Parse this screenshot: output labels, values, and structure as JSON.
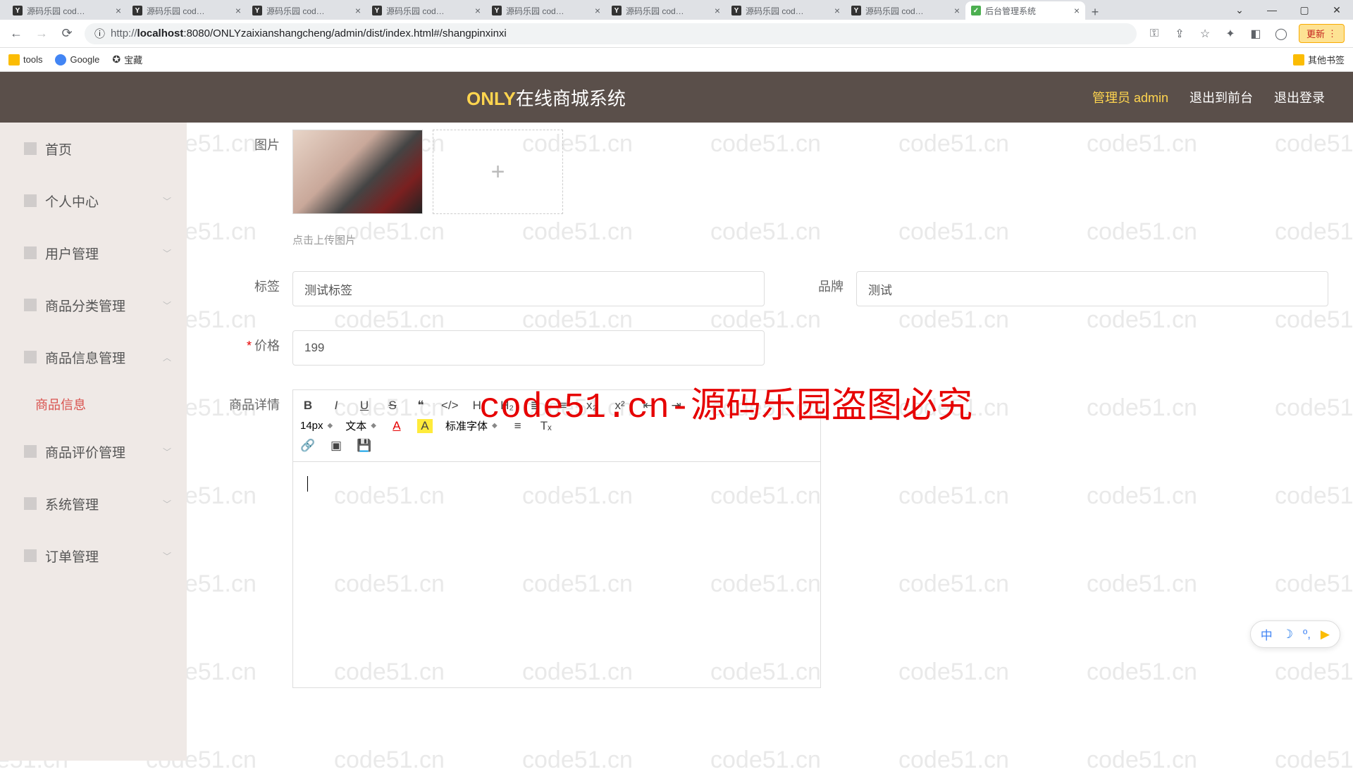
{
  "browser": {
    "tabs": [
      {
        "title": "源码乐园 cod…"
      },
      {
        "title": "源码乐园 cod…"
      },
      {
        "title": "源码乐园 cod…"
      },
      {
        "title": "源码乐园 cod…"
      },
      {
        "title": "源码乐园 cod…"
      },
      {
        "title": "源码乐园 cod…"
      },
      {
        "title": "源码乐园 cod…"
      },
      {
        "title": "源码乐园 cod…"
      },
      {
        "title": "后台管理系统",
        "active": true
      }
    ],
    "url_proto": "http://",
    "url_host": "localhost",
    "url_path": ":8080/ONLYzaixianshangcheng/admin/dist/index.html#/shangpinxinxi",
    "update": "更新",
    "bookmarks": {
      "tools": "tools",
      "google": "Google",
      "baozang": "宝藏",
      "other": "其他书签"
    }
  },
  "header": {
    "title_accent": "ONLY",
    "title_rest": "在线商城系统",
    "admin_prefix": "管理员 ",
    "admin_name": "admin",
    "to_front": "退出到前台",
    "logout": "退出登录"
  },
  "sidebar": {
    "home": "首页",
    "profile": "个人中心",
    "users": "用户管理",
    "cat": "商品分类管理",
    "info": "商品信息管理",
    "info_sub": "商品信息",
    "review": "商品评价管理",
    "system": "系统管理",
    "orders": "订单管理"
  },
  "form": {
    "image_label": "图片",
    "upload_hint": "点击上传图片",
    "tag_label": "标签",
    "tag_value": "测试标签",
    "brand_label": "品牌",
    "brand_value": "测试",
    "price_label": "价格",
    "price_value": "199",
    "detail_label": "商品详情"
  },
  "editor": {
    "size": "14px",
    "blocktype": "文本",
    "font": "标准字体",
    "b": "B",
    "i": "I",
    "u": "U",
    "s": "S",
    "quote": "❝",
    "code": "</>",
    "h1": "H₁",
    "h2": "H₂",
    "ol": "≣",
    "ul": "≡",
    "sub": "x₂",
    "sup": "x²",
    "indent_l": "⇤",
    "indent_r": "⇥",
    "colorA": "A",
    "bgA": "A",
    "align": "≡",
    "clear": "Tₓ",
    "link": "🔗",
    "img": "▣",
    "save": "💾"
  },
  "watermark": {
    "text": "code51.cn",
    "big": "code51.cn-源码乐园盗图必究"
  },
  "ime": {
    "zh": "中",
    "punct": "º,"
  }
}
